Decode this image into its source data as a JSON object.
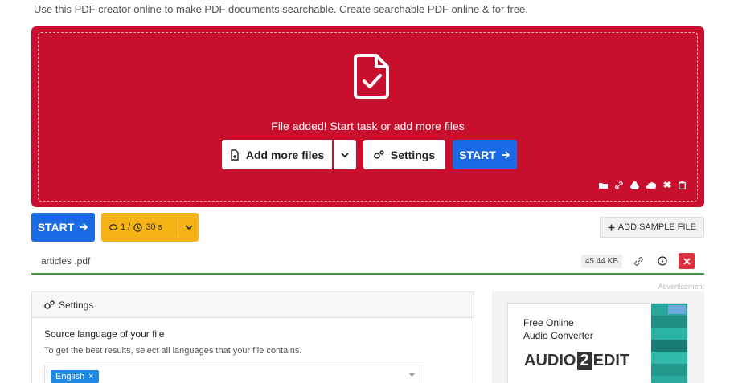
{
  "intro_text": "Use this PDF creator online to make PDF documents searchable. Create searchable PDF online & for free.",
  "dropzone": {
    "message": "File added! Start task or add more files",
    "add_more_label": "Add more files",
    "settings_label": "Settings",
    "start_label": "START",
    "background": "#c8102e"
  },
  "actions": {
    "start_label": "START",
    "credits": "1 /",
    "time": "30 s",
    "sample_label": "ADD SAMPLE FILE"
  },
  "file": {
    "name": "articles .pdf",
    "size": "45.44 KB"
  },
  "ad_label": "Advertisement",
  "settings": {
    "header": "Settings",
    "lang_title": "Source language of your file",
    "lang_desc": "To get the best results, select all languages that your file contains.",
    "selected_language": "English",
    "remove_glyph": "×"
  },
  "ad": {
    "line1": "Free Online",
    "line2": "Audio Converter",
    "logo_pre": "AUDIO",
    "logo_num": "2",
    "logo_post": "EDIT"
  },
  "colors": {
    "primary_blue": "#1b6ae5",
    "credit_yellow": "#f5b316",
    "success_green": "#3c9c3c",
    "danger_red": "#d9333f"
  }
}
